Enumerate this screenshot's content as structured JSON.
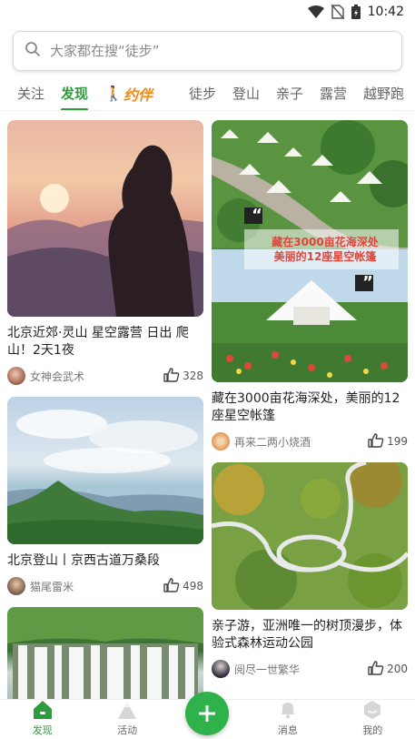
{
  "status_bar": {
    "time": "10:42"
  },
  "search": {
    "placeholder": "大家都在搜“徒步”"
  },
  "tabs": [
    {
      "label": "关注"
    },
    {
      "label": "发现"
    },
    {
      "label": "约伴"
    },
    {
      "label": "徒步"
    },
    {
      "label": "登山"
    },
    {
      "label": "亲子"
    },
    {
      "label": "露营"
    },
    {
      "label": "越野跑"
    }
  ],
  "feed": {
    "left": [
      {
        "title": "北京近郊·灵山 星空露营 日出 爬山！2天1夜",
        "author": "女神会武术",
        "likes": "328"
      },
      {
        "title": "北京登山丨京西古道万桑段",
        "author": "猫尾雷米",
        "likes": "498"
      },
      {
        "title": "",
        "author": "",
        "likes": ""
      }
    ],
    "right": [
      {
        "title": "藏在3000亩花海深处，美丽的12座星空帐篷",
        "author": "再来二两小烧酒",
        "likes": "199",
        "overlay_line1": "藏在3000亩花海深处",
        "overlay_line2": "美丽的12座星空帐篷"
      },
      {
        "title": "亲子游，亚洲唯一的树顶漫步，体验式森林运动公园",
        "author": "阅尽一世繁华",
        "likes": "200"
      }
    ]
  },
  "bottom_nav": [
    {
      "label": "发现"
    },
    {
      "label": "活动"
    },
    {
      "label": "消息"
    },
    {
      "label": "我的"
    }
  ],
  "colors": {
    "accent": "#2e9b3c",
    "brand": "#f08a1a",
    "fab": "#2fb24a"
  }
}
